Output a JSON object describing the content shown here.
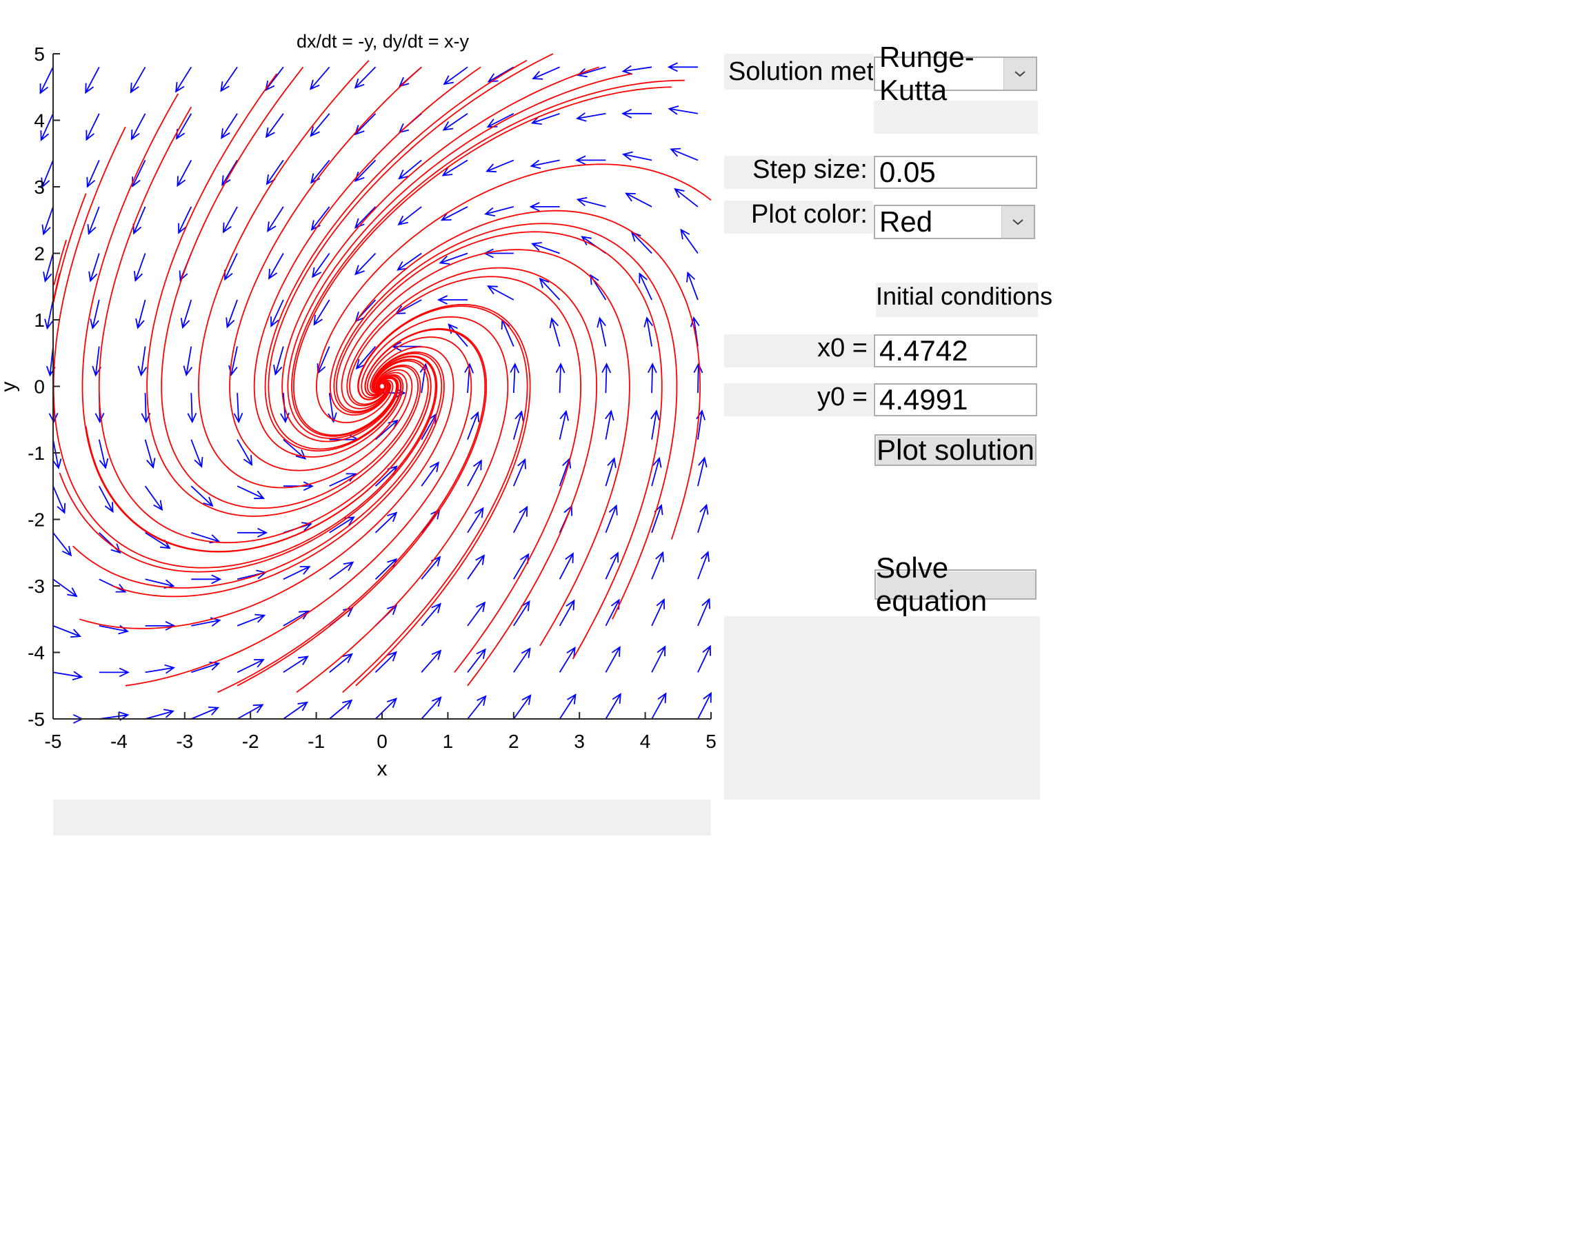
{
  "chart_data": {
    "type": "line",
    "title": "dx/dt = -y, dy/dt = x-y",
    "xlabel": "x",
    "ylabel": "y",
    "xlim": [
      -5,
      5
    ],
    "ylim": [
      -5,
      5
    ],
    "xticks": [
      "-5",
      "-4",
      "-3",
      "-2",
      "-1",
      "0",
      "1",
      "2",
      "3",
      "4",
      "5"
    ],
    "yticks": [
      "-5",
      "-4",
      "-3",
      "-2",
      "-1",
      "0",
      "1",
      "2",
      "3",
      "4",
      "5"
    ],
    "grid": false,
    "vector_field": {
      "dx": "-y",
      "dy": "x-y",
      "color": "#0000ff",
      "grid_step": 0.7
    },
    "trajectory_color": "#ff0000",
    "trajectory_starts": [
      [
        4.6,
        4.6
      ],
      [
        4.4,
        4.5
      ],
      [
        3.8,
        4.7
      ],
      [
        3.3,
        4.8
      ],
      [
        2.6,
        5.0
      ],
      [
        2.2,
        4.9
      ],
      [
        1.5,
        4.8
      ],
      [
        0.6,
        4.8
      ],
      [
        -0.2,
        4.9
      ],
      [
        -1.2,
        4.8
      ],
      [
        -1.6,
        4.7
      ],
      [
        -2.9,
        4.2
      ],
      [
        -3.1,
        4.4
      ],
      [
        -3.9,
        3.9
      ],
      [
        -4.5,
        2.9
      ],
      [
        -4.8,
        2.2
      ],
      [
        -4.9,
        1.7
      ],
      [
        -4.9,
        -1.3
      ],
      [
        -4.5,
        -0.6
      ],
      [
        -4.7,
        -2.4
      ],
      [
        -4.6,
        -3.5
      ],
      [
        -4.1,
        -3.0
      ],
      [
        -3.9,
        -4.5
      ],
      [
        -2.5,
        -4.6
      ],
      [
        -2.2,
        -4.5
      ],
      [
        -1.3,
        -4.6
      ],
      [
        -0.6,
        -4.6
      ],
      [
        -0.4,
        -4.5
      ],
      [
        1.1,
        -4.3
      ],
      [
        1.3,
        -4.5
      ],
      [
        2.4,
        -3.9
      ],
      [
        2.9,
        -4.1
      ],
      [
        3.5,
        -3.5
      ],
      [
        4.4,
        -2.3
      ],
      [
        5.0,
        2.8
      ]
    ]
  },
  "controls": {
    "method_label": "Solution method:",
    "method_value": "Runge-Kutta",
    "step_label": "Step size:",
    "step_value": "0.05",
    "color_label": "Plot color:",
    "color_value": "Red",
    "ic_label": "Initial conditions",
    "x0_label": "x0 =",
    "x0_value": "4.4742",
    "y0_label": "y0 =",
    "y0_value": "4.4991",
    "plot_button": "Plot solution",
    "solve_button": "Solve equation"
  }
}
